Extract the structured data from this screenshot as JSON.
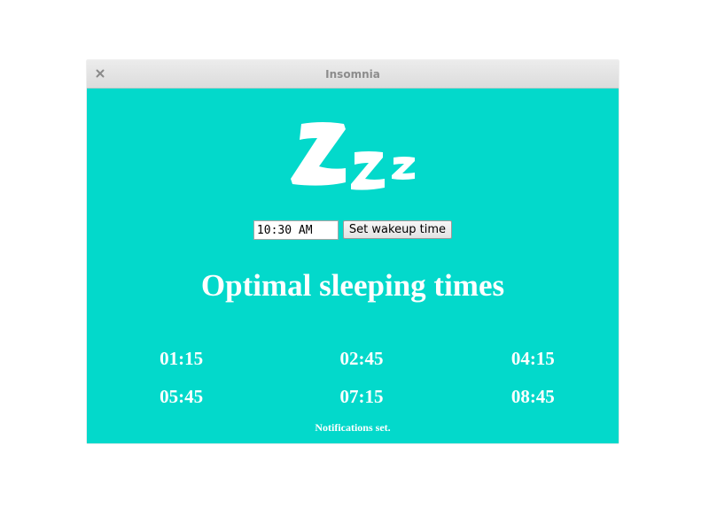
{
  "window": {
    "title": "Insomnia",
    "close_icon": "close-icon"
  },
  "logo": {
    "icon": "zzz-sleep-icon"
  },
  "form": {
    "wakeup_time_value": "10:30 AM",
    "set_button_label": "Set wakeup time"
  },
  "heading": "Optimal sleeping times",
  "times": [
    "01:15",
    "02:45",
    "04:15",
    "05:45",
    "07:15",
    "08:45"
  ],
  "status": "Notifications set.",
  "colors": {
    "background": "#03d9cb",
    "text": "#ffffff",
    "titlebar": "#e4e4e4"
  }
}
